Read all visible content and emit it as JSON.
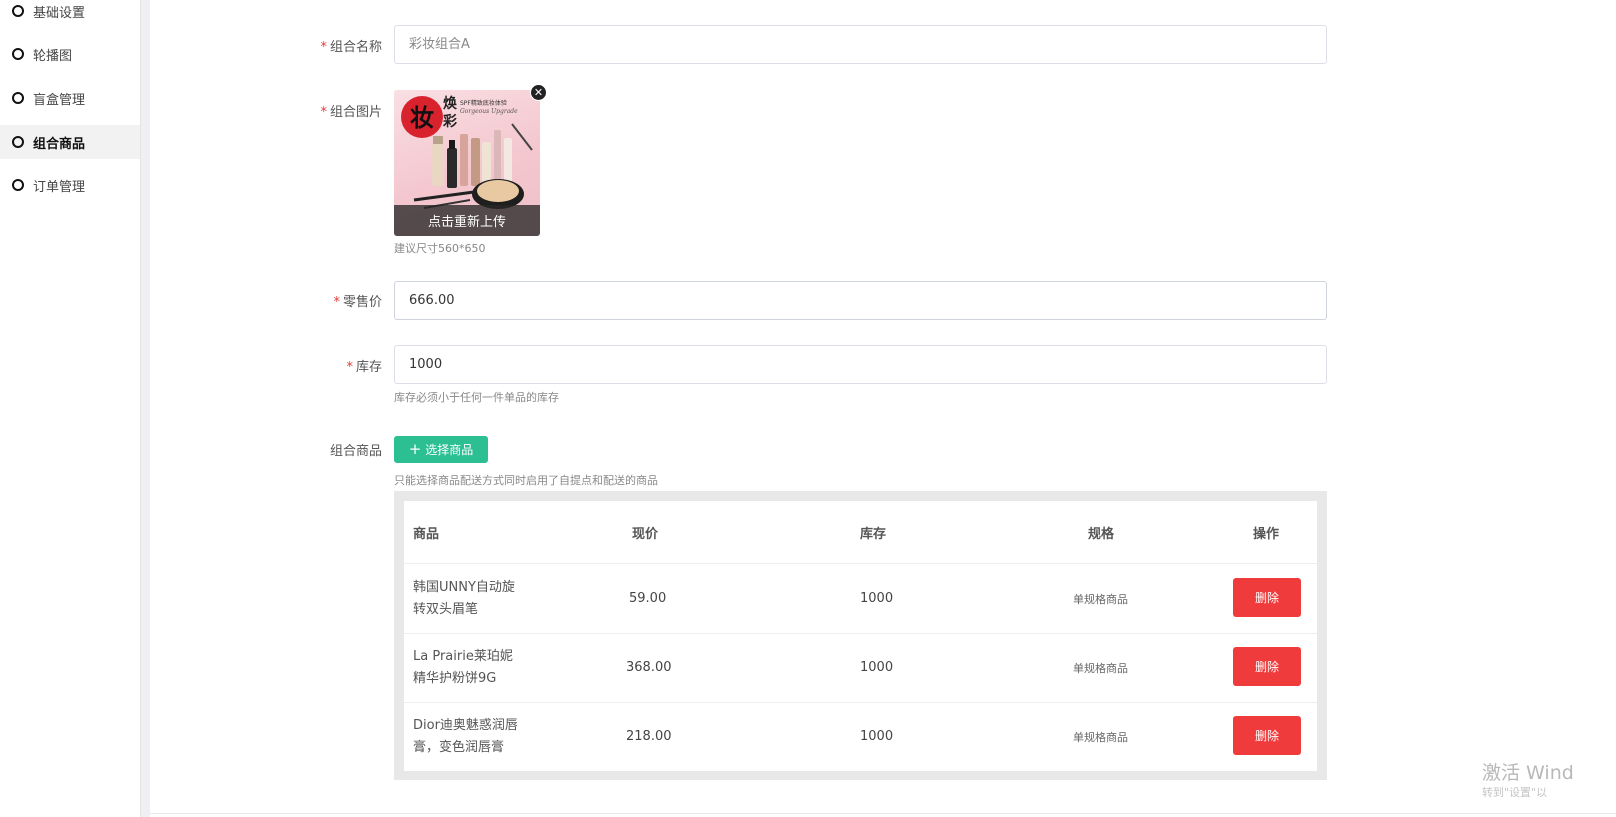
{
  "sidebar": {
    "items": [
      {
        "label": "基础设置",
        "active": false
      },
      {
        "label": "轮播图",
        "active": false
      },
      {
        "label": "盲盒管理",
        "active": false
      },
      {
        "label": "组合商品",
        "active": true
      },
      {
        "label": "订单管理",
        "active": false
      }
    ]
  },
  "form": {
    "name": {
      "label": "组合名称",
      "placeholder": "彩妆组合A",
      "value": ""
    },
    "image": {
      "label": "组合图片",
      "reupload": "点击重新上传",
      "hint": "建议尺寸560*650",
      "graphic_lines": {
        "badge_main": "妆",
        "badge_sub1": "焕",
        "badge_sub2": "彩",
        "caption": "SPF精致底妆体验",
        "caption2": "Gorgeous Upgrade"
      }
    },
    "price": {
      "label": "零售价",
      "value": "666.00"
    },
    "stock": {
      "label": "库存",
      "value": "1000",
      "hint": "库存必须小于任何一件单品的库存"
    },
    "combo": {
      "label": "组合商品",
      "select_button": "选择商品",
      "hint": "只能选择商品配送方式同时启用了自提点和配送的商品"
    }
  },
  "table": {
    "headers": {
      "product": "商品",
      "price": "现价",
      "stock": "库存",
      "spec": "规格",
      "action": "操作"
    },
    "rows": [
      {
        "name_line1": "韩国UNNY自动旋",
        "name_line2": "转双头眉笔",
        "price": "59.00",
        "stock": "1000",
        "spec": "单规格商品",
        "action": "删除"
      },
      {
        "name_line1": "La Prairie莱珀妮",
        "name_line2": "精华护粉饼9G",
        "price": "368.00",
        "stock": "1000",
        "spec": "单规格商品",
        "action": "删除"
      },
      {
        "name_line1": "Dior迪奥魅惑润唇",
        "name_line2": "膏，变色润唇膏",
        "price": "218.00",
        "stock": "1000",
        "spec": "单规格商品",
        "action": "删除"
      }
    ]
  },
  "watermark": {
    "line1": "激活 Wind",
    "line2": "转到\"设置\"以"
  },
  "colors": {
    "accent": "#2bbf92",
    "danger": "#ef3b3b",
    "required": "#e53935"
  }
}
